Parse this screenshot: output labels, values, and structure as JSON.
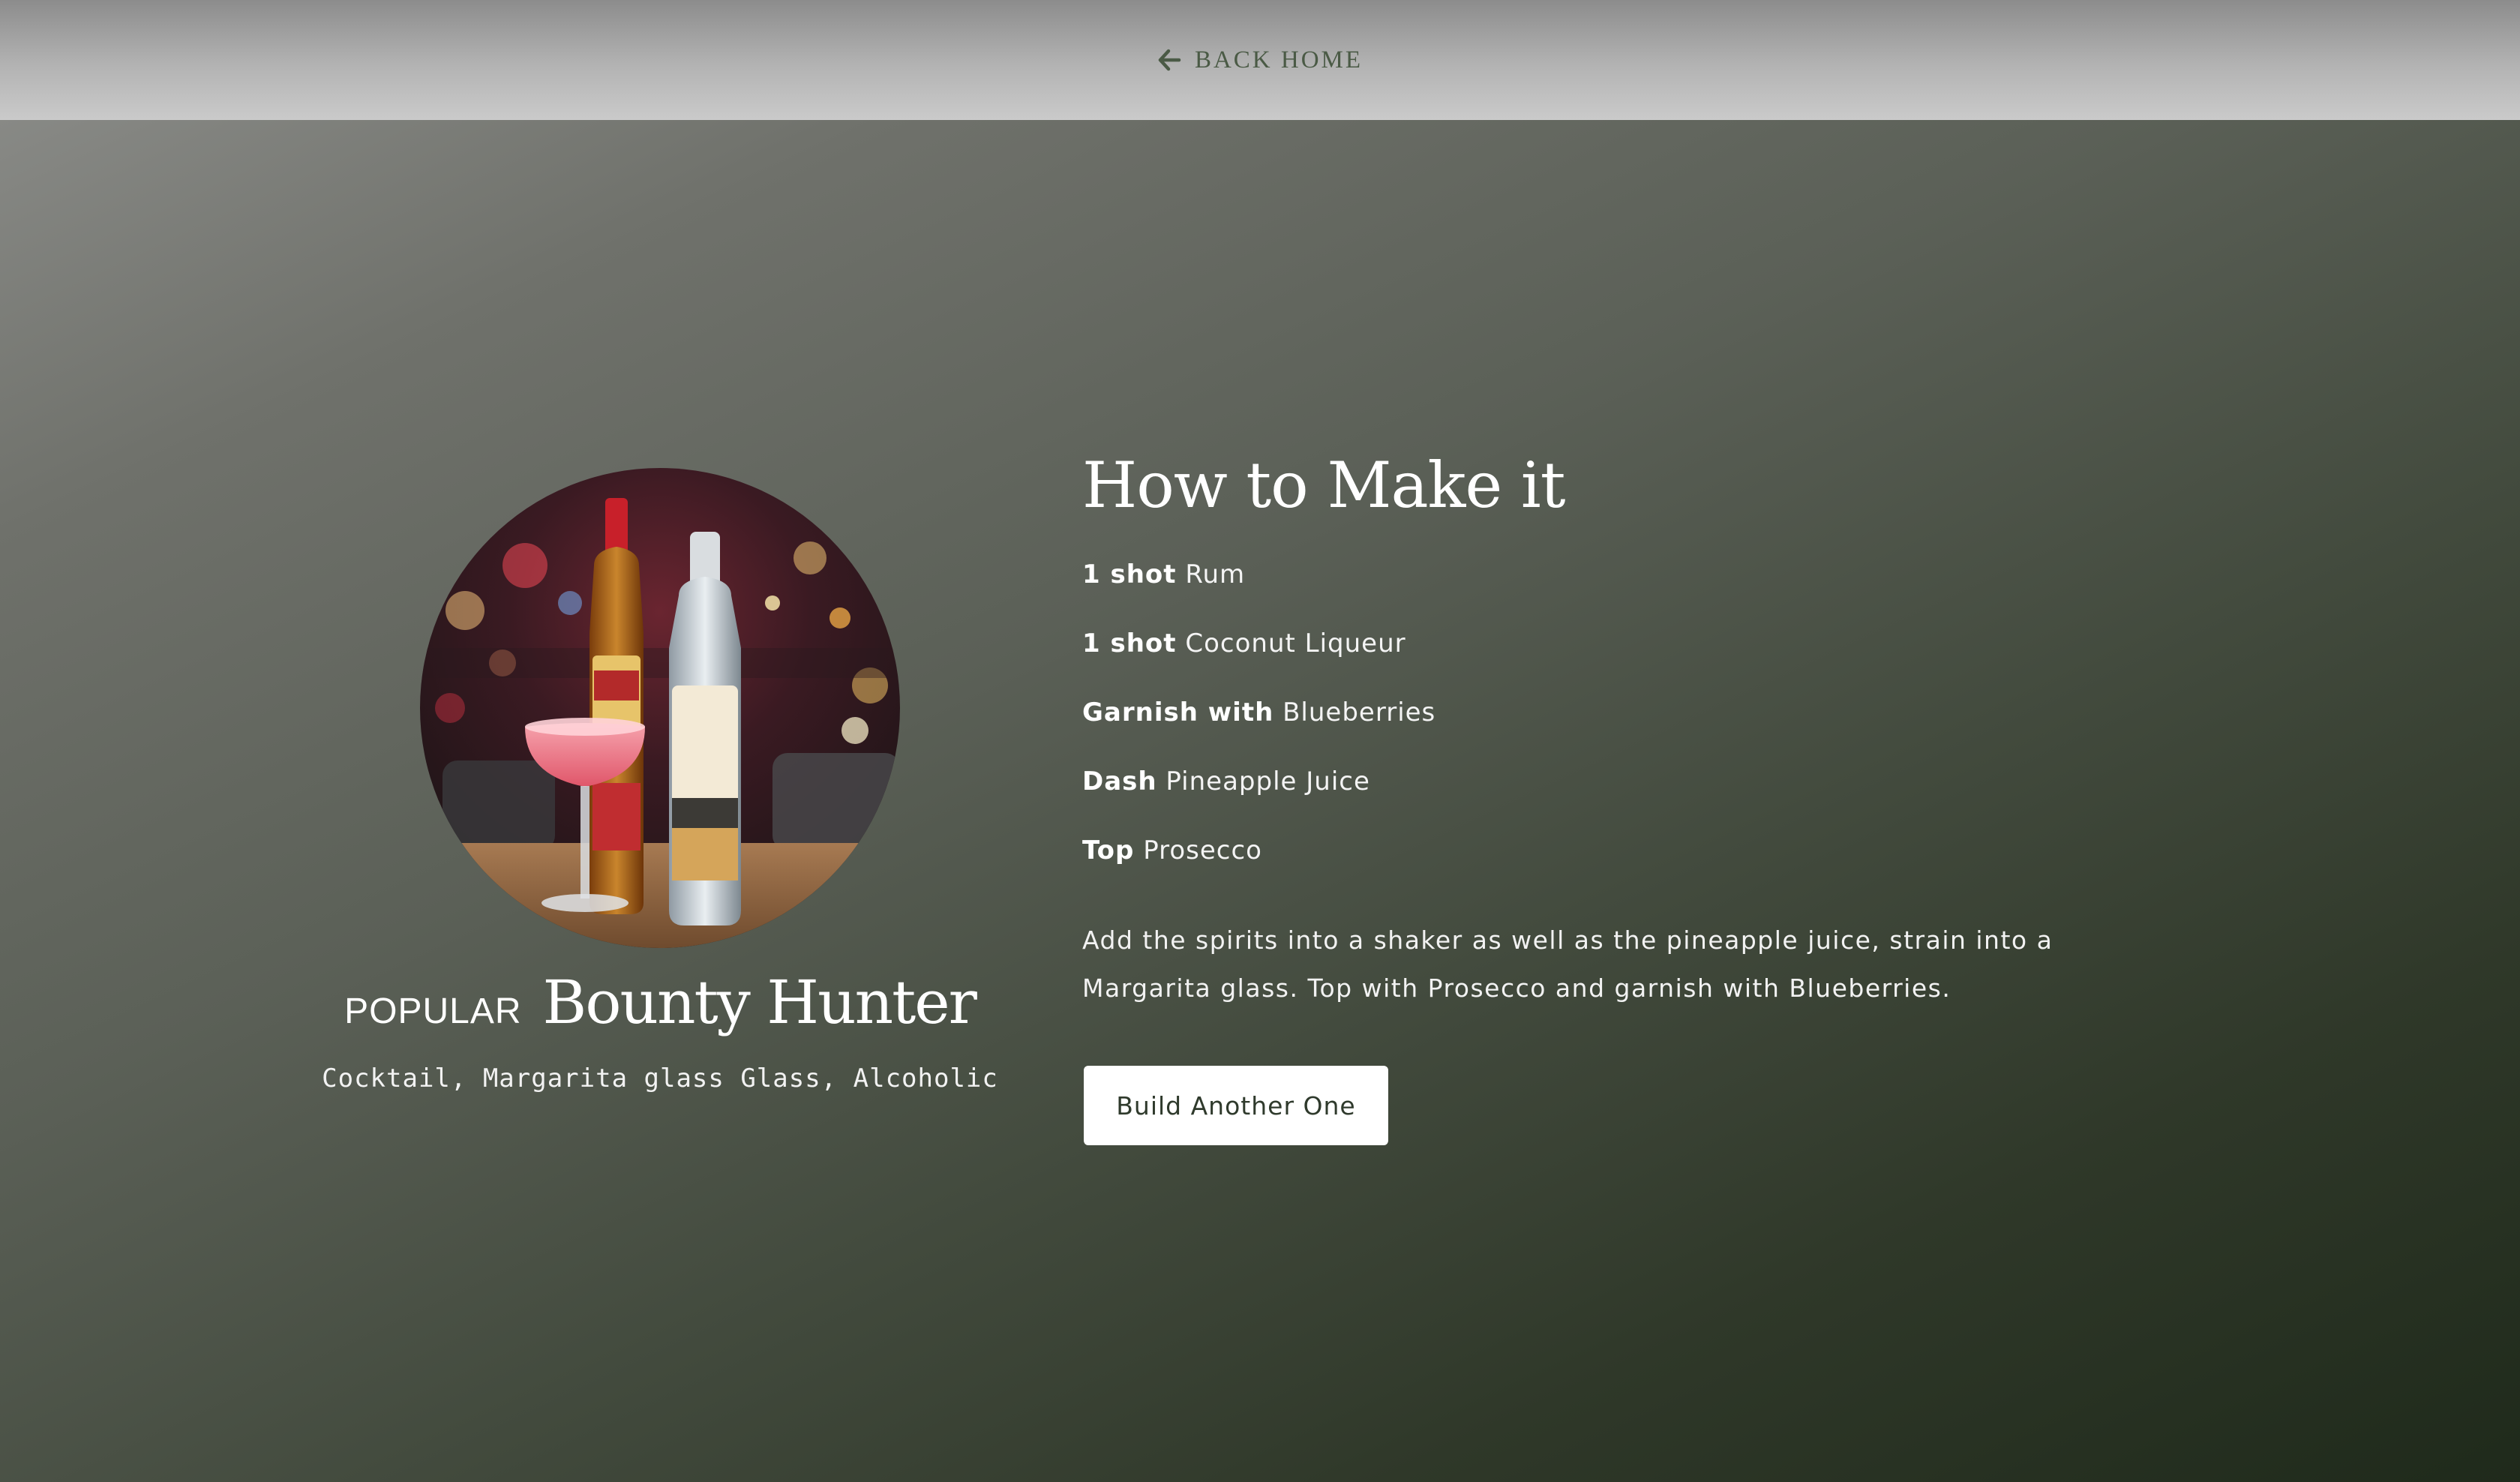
{
  "nav": {
    "back_label": "BACK HOME",
    "back_icon": "arrow-left-icon"
  },
  "drink": {
    "badge": "POPULAR",
    "name": "Bounty Hunter",
    "meta": "Cocktail, Margarita glass Glass, Alcoholic",
    "photo": "cocktail-photo-bottles-and-pink-margarita"
  },
  "recipe": {
    "heading": "How to Make it",
    "ingredients": [
      {
        "measure": "1 shot",
        "name": "Rum"
      },
      {
        "measure": "1 shot",
        "name": "Coconut Liqueur"
      },
      {
        "measure": "Garnish with",
        "name": "Blueberries"
      },
      {
        "measure": "Dash",
        "name": "Pineapple Juice"
      },
      {
        "measure": "Top",
        "name": "Prosecco"
      }
    ],
    "instructions": "Add the spirits into a shaker as well as the pineapple juice, strain into a Margarita glass. Top with Prosecco and garnish with Blueberries."
  },
  "actions": {
    "build_label": "Build Another One"
  },
  "colors": {
    "nav_text": "#4a5a45",
    "button_bg": "#ffffff",
    "button_text": "#2f3a2c",
    "bg_top": "#8f908d",
    "bg_bottom": "#1f2a1b"
  }
}
